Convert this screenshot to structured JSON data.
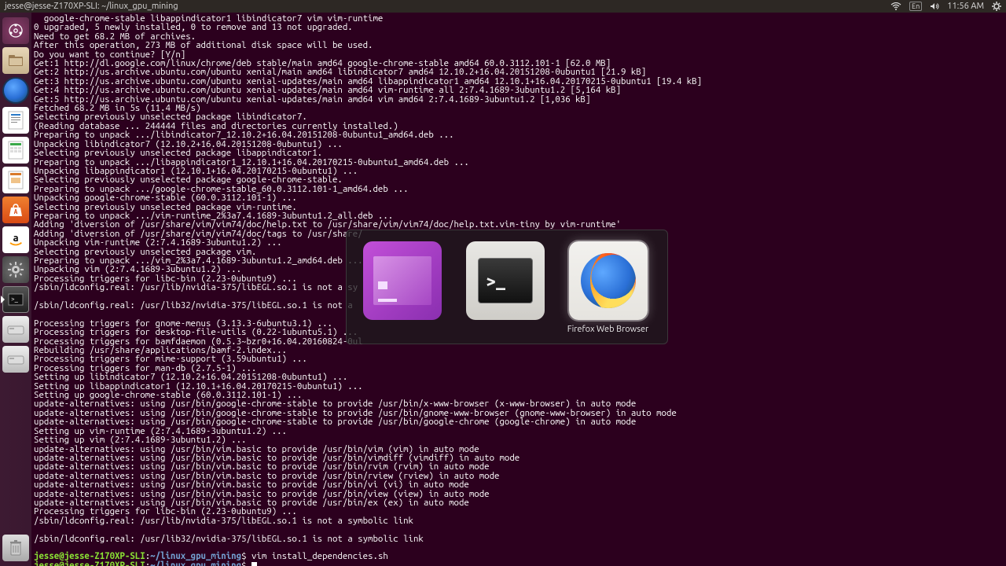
{
  "topbar": {
    "title": "jesse@jesse-Z170XP-SLI: ~/linux_gpu_mining",
    "time": "11:56 AM",
    "lang": "En"
  },
  "launcher": {
    "items": [
      {
        "name": "dash",
        "label": "Search"
      },
      {
        "name": "files",
        "label": "Files"
      },
      {
        "name": "firefox",
        "label": "Firefox"
      },
      {
        "name": "writer",
        "label": "Writer"
      },
      {
        "name": "calc",
        "label": "Calc"
      },
      {
        "name": "impress",
        "label": "Impress"
      },
      {
        "name": "software",
        "label": "Ubuntu Software"
      },
      {
        "name": "amazon",
        "label": "Amazon"
      },
      {
        "name": "settings",
        "label": "System Settings"
      },
      {
        "name": "terminal",
        "label": "Terminal"
      },
      {
        "name": "disk1",
        "label": "Disk"
      },
      {
        "name": "disk2",
        "label": "Disk"
      }
    ],
    "trash": "Trash"
  },
  "alttab": {
    "apps": [
      {
        "name": "window-manager",
        "label": ""
      },
      {
        "name": "terminal",
        "label": ""
      },
      {
        "name": "firefox",
        "label": "Firefox Web Browser"
      }
    ],
    "selected": 2
  },
  "terminal": {
    "lines": [
      "  google-chrome-stable libappindicator1 libindicator7 vim vim-runtime",
      "0 upgraded, 5 newly installed, 0 to remove and 13 not upgraded.",
      "Need to get 68.2 MB of archives.",
      "After this operation, 273 MB of additional disk space will be used.",
      "Do you want to continue? [Y/n]",
      "Get:1 http://dl.google.com/linux/chrome/deb stable/main amd64 google-chrome-stable amd64 60.0.3112.101-1 [62.0 MB]",
      "Get:2 http://us.archive.ubuntu.com/ubuntu xenial/main amd64 libindicator7 amd64 12.10.2+16.04.20151208-0ubuntu1 [21.9 kB]",
      "Get:3 http://us.archive.ubuntu.com/ubuntu xenial-updates/main amd64 libappindicator1 amd64 12.10.1+16.04.20170215-0ubuntu1 [19.4 kB]",
      "Get:4 http://us.archive.ubuntu.com/ubuntu xenial-updates/main amd64 vim-runtime all 2:7.4.1689-3ubuntu1.2 [5,164 kB]",
      "Get:5 http://us.archive.ubuntu.com/ubuntu xenial-updates/main amd64 vim amd64 2:7.4.1689-3ubuntu1.2 [1,036 kB]",
      "Fetched 68.2 MB in 5s (11.4 MB/s)",
      "Selecting previously unselected package libindicator7.",
      "(Reading database ... 244444 files and directories currently installed.)",
      "Preparing to unpack .../libindicator7_12.10.2+16.04.20151208-0ubuntu1_amd64.deb ...",
      "Unpacking libindicator7 (12.10.2+16.04.20151208-0ubuntu1) ...",
      "Selecting previously unselected package libappindicator1.",
      "Preparing to unpack .../libappindicator1_12.10.1+16.04.20170215-0ubuntu1_amd64.deb ...",
      "Unpacking libappindicator1 (12.10.1+16.04.20170215-0ubuntu1) ...",
      "Selecting previously unselected package google-chrome-stable.",
      "Preparing to unpack .../google-chrome-stable_60.0.3112.101-1_amd64.deb ...",
      "Unpacking google-chrome-stable (60.0.3112.101-1) ...",
      "Selecting previously unselected package vim-runtime.",
      "Preparing to unpack .../vim-runtime_2%3a7.4.1689-3ubuntu1.2_all.deb ...",
      "Adding 'diversion of /usr/share/vim/vim74/doc/help.txt to /usr/share/vim/vim74/doc/help.txt.vim-tiny by vim-runtime'",
      "Adding 'diversion of /usr/share/vim/vim74/doc/tags to /usr/share/",
      "Unpacking vim-runtime (2:7.4.1689-3ubuntu1.2) ...",
      "Selecting previously unselected package vim.",
      "Preparing to unpack .../vim_2%3a7.4.1689-3ubuntu1.2_amd64.deb ...",
      "Unpacking vim (2:7.4.1689-3ubuntu1.2) ...",
      "Processing triggers for libc-bin (2.23-0ubuntu9) ...",
      "/sbin/ldconfig.real: /usr/lib/nvidia-375/libEGL.so.1 is not a sy",
      "",
      "/sbin/ldconfig.real: /usr/lib32/nvidia-375/libEGL.so.1 is not a ",
      "",
      "Processing triggers for gnome-menus (3.13.3-6ubuntu3.1) ...",
      "Processing triggers for desktop-file-utils (0.22-1ubuntu5.1) ...",
      "Processing triggers for bamfdaemon (0.5.3~bzr0+16.04.20160824-0ul",
      "Rebuilding /usr/share/applications/bamf-2.index...",
      "Processing triggers for mime-support (3.59ubuntu1) ...",
      "Processing triggers for man-db (2.7.5-1) ...",
      "Setting up libindicator7 (12.10.2+16.04.20151208-0ubuntu1) ...",
      "Setting up libappindicator1 (12.10.1+16.04.20170215-0ubuntu1) ...",
      "Setting up google-chrome-stable (60.0.3112.101-1) ...",
      "update-alternatives: using /usr/bin/google-chrome-stable to provide /usr/bin/x-www-browser (x-www-browser) in auto mode",
      "update-alternatives: using /usr/bin/google-chrome-stable to provide /usr/bin/gnome-www-browser (gnome-www-browser) in auto mode",
      "update-alternatives: using /usr/bin/google-chrome-stable to provide /usr/bin/google-chrome (google-chrome) in auto mode",
      "Setting up vim-runtime (2:7.4.1689-3ubuntu1.2) ...",
      "Setting up vim (2:7.4.1689-3ubuntu1.2) ...",
      "update-alternatives: using /usr/bin/vim.basic to provide /usr/bin/vim (vim) in auto mode",
      "update-alternatives: using /usr/bin/vim.basic to provide /usr/bin/vimdiff (vimdiff) in auto mode",
      "update-alternatives: using /usr/bin/vim.basic to provide /usr/bin/rvim (rvim) in auto mode",
      "update-alternatives: using /usr/bin/vim.basic to provide /usr/bin/rview (rview) in auto mode",
      "update-alternatives: using /usr/bin/vim.basic to provide /usr/bin/vi (vi) in auto mode",
      "update-alternatives: using /usr/bin/vim.basic to provide /usr/bin/view (view) in auto mode",
      "update-alternatives: using /usr/bin/vim.basic to provide /usr/bin/ex (ex) in auto mode",
      "Processing triggers for libc-bin (2.23-0ubuntu9) ...",
      "/sbin/ldconfig.real: /usr/lib/nvidia-375/libEGL.so.1 is not a symbolic link",
      "",
      "/sbin/ldconfig.real: /usr/lib32/nvidia-375/libEGL.so.1 is not a symbolic link",
      ""
    ],
    "prompt": {
      "user": "jesse@jesse-Z170XP-SLI",
      "colon": ":",
      "path": "~/linux_gpu_mining",
      "dollar": "$ ",
      "cmd1": "vim install_dependencies.sh",
      "cmd2": ""
    }
  }
}
